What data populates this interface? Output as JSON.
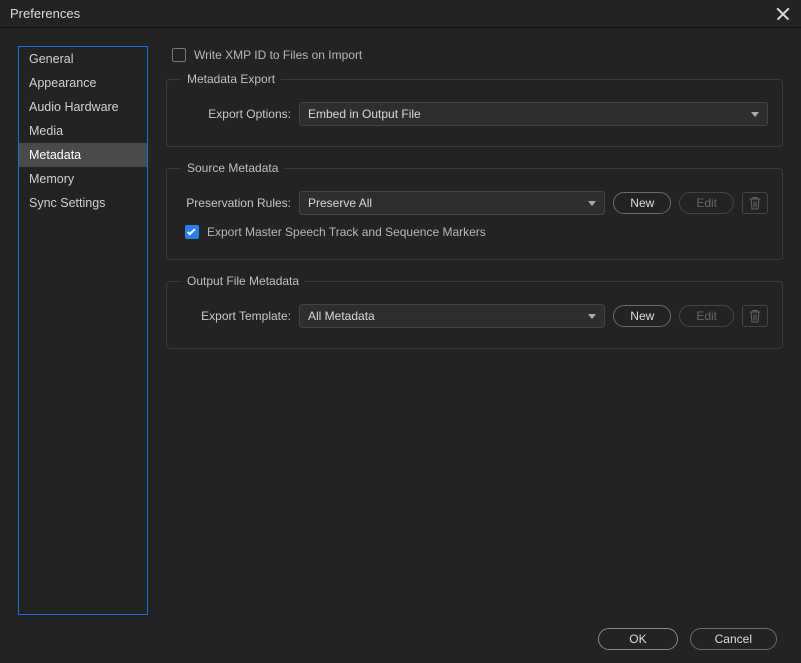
{
  "window": {
    "title": "Preferences"
  },
  "sidebar": {
    "items": [
      {
        "label": "General"
      },
      {
        "label": "Appearance"
      },
      {
        "label": "Audio Hardware"
      },
      {
        "label": "Media"
      },
      {
        "label": "Metadata"
      },
      {
        "label": "Memory"
      },
      {
        "label": "Sync Settings"
      }
    ],
    "selected_index": 4
  },
  "main": {
    "write_xmp_label": "Write XMP ID to Files on Import",
    "write_xmp_checked": false,
    "metadata_export": {
      "legend": "Metadata Export",
      "export_options_label": "Export Options:",
      "export_options_value": "Embed in Output File"
    },
    "source_metadata": {
      "legend": "Source Metadata",
      "preservation_rules_label": "Preservation Rules:",
      "preservation_rules_value": "Preserve All",
      "new_label": "New",
      "edit_label": "Edit",
      "export_master_label": "Export Master Speech Track and Sequence Markers",
      "export_master_checked": true
    },
    "output_file_metadata": {
      "legend": "Output File Metadata",
      "export_template_label": "Export Template:",
      "export_template_value": "All Metadata",
      "new_label": "New",
      "edit_label": "Edit"
    }
  },
  "footer": {
    "ok_label": "OK",
    "cancel_label": "Cancel"
  }
}
